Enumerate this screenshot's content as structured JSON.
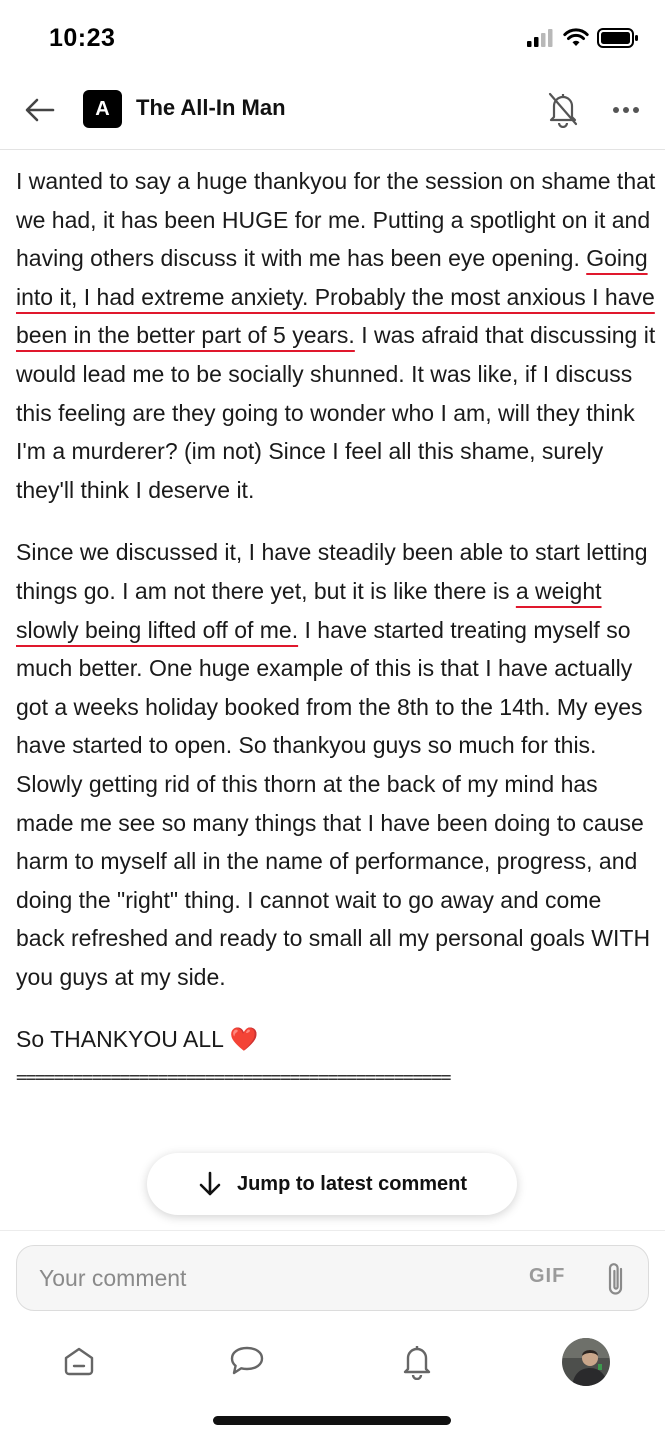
{
  "status": {
    "time": "10:23"
  },
  "header": {
    "badge_letter": "A",
    "title": "The All-In Man"
  },
  "post": {
    "p1": {
      "before": "I wanted to say a huge thankyou for the session on shame that we had, it has been HUGE for me. Putting a spotlight on it and having others discuss it with me has been eye opening. ",
      "highlight": "Going into it, I had extreme anxiety. Probably the most anxious I have been in the better part of 5 years.",
      "after": " I was afraid that discussing it would lead me to be socially shunned. It was like, if I discuss this feeling are they going to wonder who I am, will they think I'm a murderer? (im not) Since I feel all this shame, surely they'll think I deserve it."
    },
    "p2": {
      "before": "Since we discussed it, I have steadily been able to start letting things go. I am not there yet, but it is like there is ",
      "highlight": "a weight slowly being lifted off of me.",
      "after": " I have started treating myself so much better. One huge example of this is that I have actually got a weeks holiday booked from the 8th to the 14th. My eyes have started to open. So thankyou guys so much for this. Slowly getting rid of this thorn at the back of my mind has made me see so many things that I have been doing to cause harm to myself all in the name of performance, progress, and doing the \"right\" thing. I cannot wait to go away and come back refreshed and ready to small all my personal goals WITH you guys at my side."
    },
    "p3": "So THANKYOU ALL ❤️",
    "divider": "=============================================="
  },
  "jump_button": {
    "label": "Jump to latest comment"
  },
  "composer": {
    "placeholder": "Your comment",
    "gif_label": "GIF"
  },
  "colors": {
    "highlight_underline": "#e0182d",
    "badge_bg": "#000000"
  }
}
